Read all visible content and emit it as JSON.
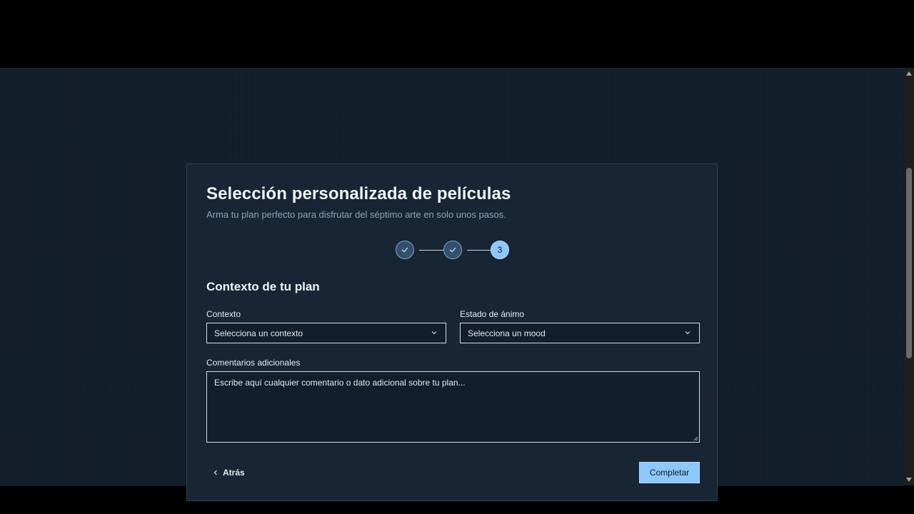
{
  "form": {
    "title": "Selección personalizada de películas",
    "subtitle": "Arma tu plan perfecto para disfrutar del séptimo arte en solo unos pasos.",
    "stepper": {
      "steps": [
        {
          "state": "completed",
          "icon": "check-icon"
        },
        {
          "state": "completed",
          "icon": "check-icon"
        },
        {
          "state": "active",
          "label": "3"
        }
      ]
    },
    "section_title": "Contexto de tu plan",
    "context": {
      "label": "Contexto",
      "value": "Selecciona un contexto"
    },
    "mood": {
      "label": "Estado de ánimo",
      "value": "Selecciona un mood"
    },
    "comments": {
      "label": "Comentarios adicionales",
      "placeholder": "Escribe aquí cualquier comentario o dato adicional sobre tu plan..."
    },
    "back_label": "Atrás",
    "complete_label": "Completar"
  },
  "colors": {
    "background": "#0f1c28",
    "card": "#172535",
    "accent": "#8ec7fb",
    "step_done": "#34506d"
  }
}
